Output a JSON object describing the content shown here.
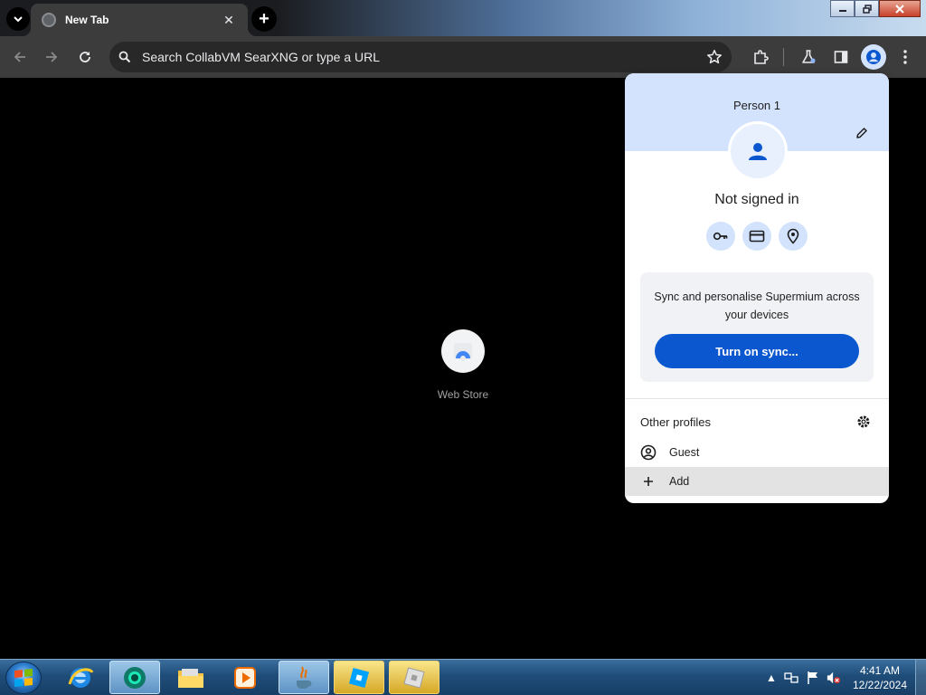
{
  "browser": {
    "tab": {
      "title": "New Tab"
    },
    "omnibox": {
      "placeholder": "Search CollabVM SearXNG or type a URL"
    }
  },
  "page": {
    "shortcuts": [
      {
        "label": "Web Store"
      }
    ]
  },
  "profile_menu": {
    "name": "Person 1",
    "status": "Not signed in",
    "sync": {
      "description": "Sync and personalise Supermium across your devices",
      "button_label": "Turn on sync..."
    },
    "other_profiles_label": "Other profiles",
    "rows": [
      {
        "label": "Guest",
        "icon": "guest-profile-icon"
      },
      {
        "label": "Add",
        "icon": "plus-icon"
      }
    ],
    "colors": {
      "header": "#d3e3fd",
      "sync_button": "#0b57d0"
    }
  },
  "taskbar": {
    "clock": {
      "time": "4:41 AM",
      "date": "12/22/2024"
    },
    "apps": [
      "internet-explorer",
      "supermium",
      "file-explorer",
      "media-player",
      "java",
      "roblox-studio",
      "roblox-player"
    ]
  }
}
